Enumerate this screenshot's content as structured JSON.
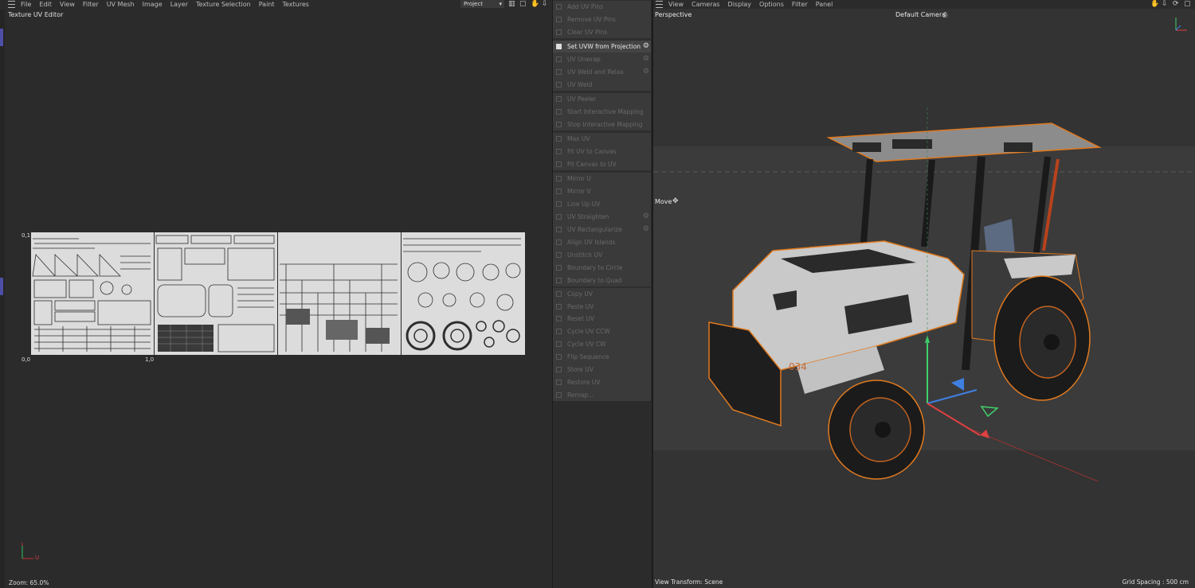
{
  "left_menu": [
    "File",
    "Edit",
    "View",
    "Filter",
    "UV Mesh",
    "Image",
    "Layer",
    "Texture Selection",
    "Paint",
    "Textures"
  ],
  "project_dropdown": "Project",
  "uv_editor": {
    "title": "Texture UV Editor",
    "label_top": "0,1",
    "label_origin": "0,0",
    "label_right": "1,0",
    "axis_u": "U",
    "zoom": "Zoom: 65.0%"
  },
  "commands": {
    "pins": [
      "Add UV Pins",
      "Remove UV Pins",
      "Clear UV Pins"
    ],
    "projection": [
      "Set UVW from Projection",
      "UV Unwrap",
      "UV Weld and Relax",
      "UV Weld"
    ],
    "peeler": [
      "UV Peeler",
      "Start Interactive Mapping",
      "Stop Interactive Mapping"
    ],
    "fit": [
      "Max UV",
      "Fit UV to Canvas",
      "Fit Canvas to UV"
    ],
    "align": [
      "Mirror U",
      "Mirror V",
      "Line Up UV",
      "UV Straighten",
      "UV Rectangularize",
      "Align UV Islands",
      "Unstitch UV",
      "Boundary to Circle",
      "Boundary to Quad"
    ],
    "clipboard": [
      "Copy UV",
      "Paste UV",
      "Reset UV",
      "Cycle UV CCW",
      "Cycle UV CW",
      "Flip Sequence",
      "Store UV",
      "Restore UV",
      "Remap..."
    ]
  },
  "viewport": {
    "menu": [
      "View",
      "Cameras",
      "Display",
      "Options",
      "Filter",
      "Panel"
    ],
    "view_name": "Perspective",
    "camera": "Default Camera",
    "tool": "Move",
    "transform": "View Transform: Scene",
    "grid": "Grid Spacing : 500 cm",
    "tractor_number": "034"
  },
  "colors": {
    "accent": "#4d4fa7",
    "selection_outline": "#e07a1f",
    "axis_x": "#e04040",
    "axis_y": "#3fd16a",
    "axis_z": "#3f7fe0"
  }
}
